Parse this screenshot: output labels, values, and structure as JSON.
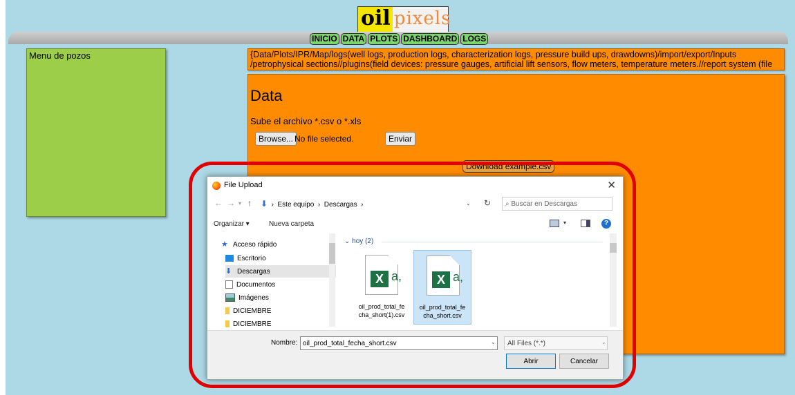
{
  "logo": {
    "part1": "oil",
    "part2": "pixels"
  },
  "nav": [
    "INICIO",
    "DATA",
    "PLOTS",
    "DASHBOARD",
    "LOGS"
  ],
  "sidebar": {
    "title": "Menu de pozos"
  },
  "info": {
    "text": "{Data/Plots/IPR/Map/logs(well logs, production logs, characterization logs, pressure build ups, drawdowns)/import/export/Inputs /petrophysical sections//plugins(field devices: pressure gauges, artificial lift sensors, flow meters, temperature meters.//report system (file creation)}"
  },
  "data_panel": {
    "title": "Data",
    "upload_label": "Sube el archivo *.csv o *.xls",
    "browse_label": "Browse...",
    "no_file": "No file selected.",
    "submit_label": "Enviar",
    "download_label": "Download example.csv"
  },
  "dialog": {
    "title": "File Upload",
    "path": [
      "Este equipo",
      "Descargas"
    ],
    "search_placeholder": "Buscar en Descargas",
    "toolbar": {
      "organize": "Organizar ▾",
      "new_folder": "Nueva carpeta"
    },
    "nav_items": [
      {
        "label": "Acceso rápido",
        "icon": "star-icon"
      },
      {
        "label": "Escritorio",
        "icon": "desktop-icon"
      },
      {
        "label": "Descargas",
        "icon": "downloads-icon"
      },
      {
        "label": "Documentos",
        "icon": "documents-icon"
      },
      {
        "label": "Imágenes",
        "icon": "pictures-icon"
      },
      {
        "label": "DICIEMBRE",
        "icon": "folder-icon"
      },
      {
        "label": "DICIEMBRE",
        "icon": "folder-icon"
      }
    ],
    "group_label": "hoy (2)",
    "files": [
      {
        "name_line1": "oil_prod_total_fe",
        "name_line2": "cha_short(1).csv",
        "selected": false
      },
      {
        "name_line1": "oil_prod_total_fe",
        "name_line2": "cha_short.csv",
        "selected": true
      }
    ],
    "filename_label": "Nombre:",
    "filename_value": "oil_prod_total_fecha_short.csv",
    "filter_value": "All Files (*.*)",
    "open_label": "Abrir",
    "cancel_label": "Cancelar"
  },
  "colors": {
    "background": "#add8e6",
    "nav_button": "#7dd36e",
    "sidebar": "#9dce4a",
    "panel": "#ff8c00",
    "highlight": "#e00000"
  }
}
